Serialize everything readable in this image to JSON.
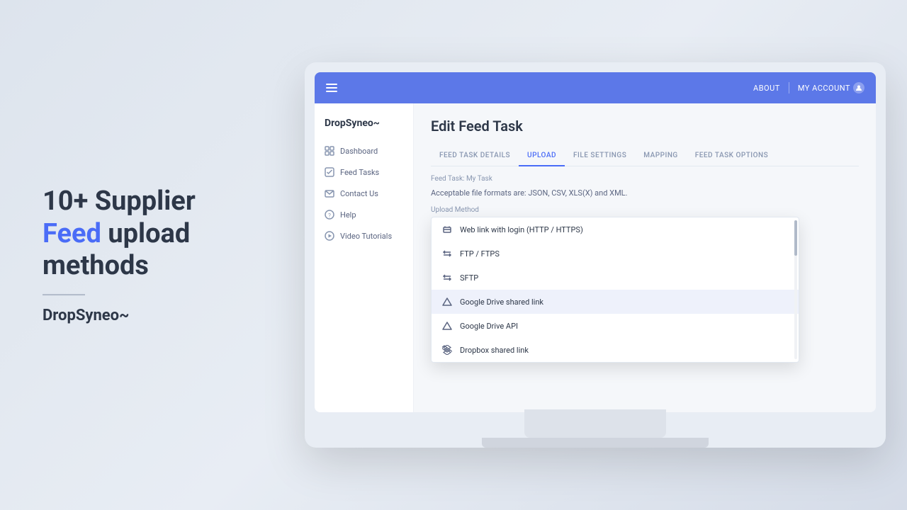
{
  "promo": {
    "line1": "10+ Supplier",
    "line2_normal": "Feed",
    "line2_highlight": " upload",
    "line3": "methods",
    "divider": true,
    "logo_drop": "Drop",
    "logo_syneo": "Syneo",
    "logo_tilde": "o"
  },
  "header": {
    "about_label": "ABOUT",
    "my_account_label": "MY ACCOUNT",
    "hamburger_label": "menu"
  },
  "sidebar": {
    "logo_drop": "Drop",
    "logo_syneo": "Syneo",
    "items": [
      {
        "label": "Dashboard",
        "icon": "grid-icon"
      },
      {
        "label": "Feed Tasks",
        "icon": "check-square-icon"
      },
      {
        "label": "Contact Us",
        "icon": "envelope-icon"
      },
      {
        "label": "Help",
        "icon": "help-circle-icon"
      },
      {
        "label": "Video Tutorials",
        "icon": "play-circle-icon"
      }
    ]
  },
  "page": {
    "title": "Edit Feed Task",
    "tabs": [
      {
        "label": "FEED TASK DETAILS",
        "active": false
      },
      {
        "label": "UPLOAD",
        "active": true
      },
      {
        "label": "FILE SETTINGS",
        "active": false
      },
      {
        "label": "MAPPING",
        "active": false
      },
      {
        "label": "FEED TASK OPTIONS",
        "active": false
      }
    ],
    "breadcrumb": "Feed Task: My Task",
    "acceptable_formats": "Acceptable file formats are: JSON, CSV, XLS(X) and XML.",
    "upload_method_label": "Upload Method",
    "dropdown": {
      "selected_item": "Google Drive shared link",
      "items": [
        {
          "label": "Web link with login (HTTP / HTTPS)",
          "icon": "link-icon"
        },
        {
          "label": "FTP / FTPS",
          "icon": "arrows-icon"
        },
        {
          "label": "SFTP",
          "icon": "arrows-icon"
        },
        {
          "label": "Google Drive shared link",
          "icon": "triangle-icon",
          "selected": true
        },
        {
          "label": "Google Drive API",
          "icon": "triangle-icon"
        },
        {
          "label": "Dropbox shared link",
          "icon": "dropbox-icon"
        }
      ]
    }
  }
}
